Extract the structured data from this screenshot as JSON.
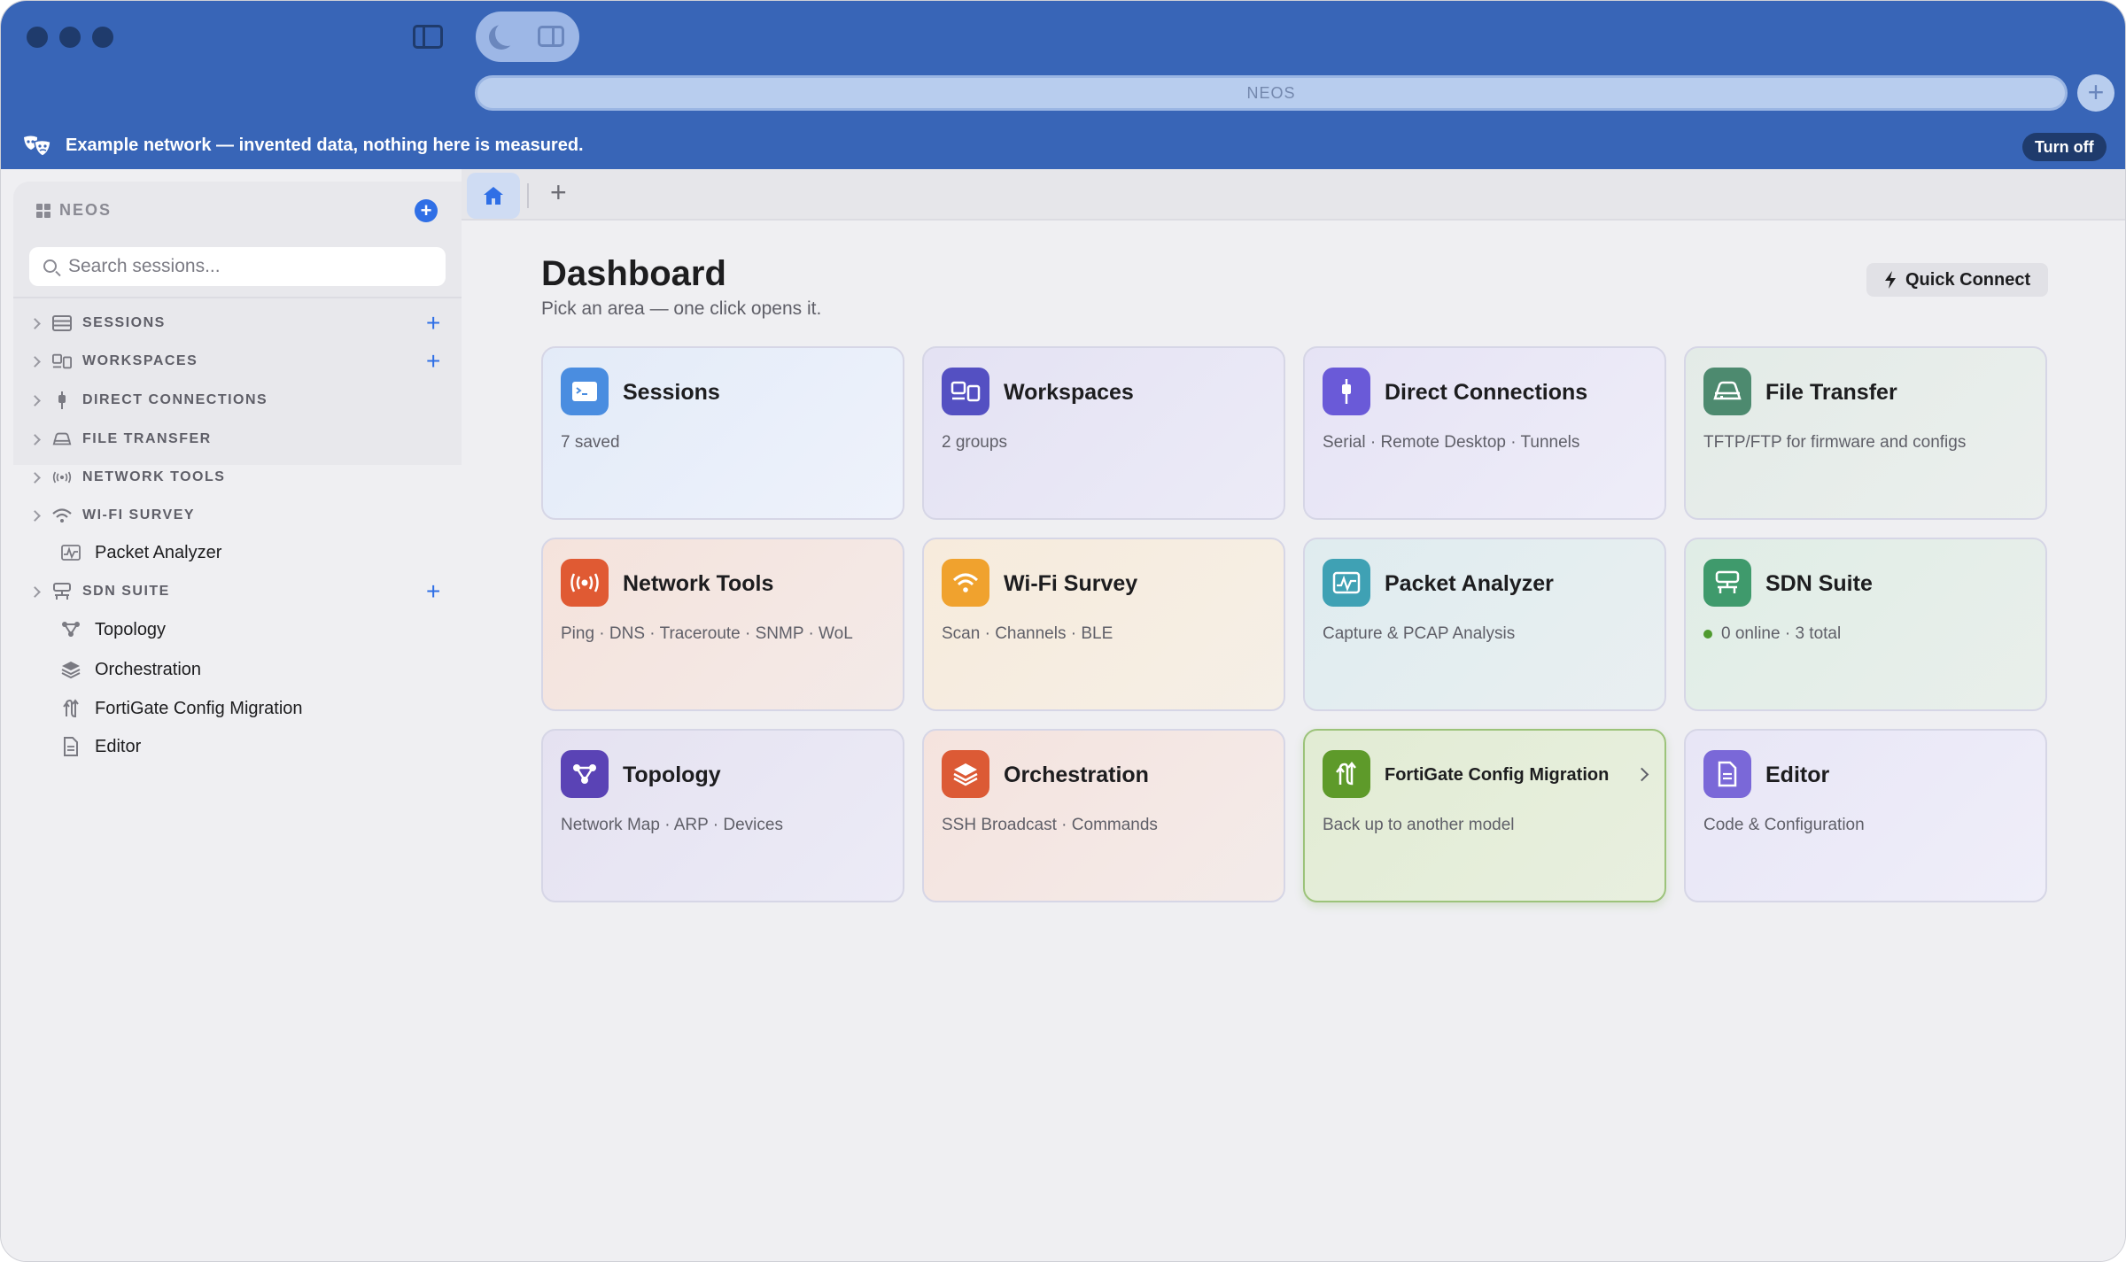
{
  "app": {
    "address": "NEOS",
    "banner_text": "Example network — invented data, nothing here is measured.",
    "banner_action": "Turn off"
  },
  "sidebar": {
    "brand": "NEOS",
    "search_placeholder": "Search sessions...",
    "items": [
      {
        "label": "SESSIONS",
        "icon": "server-icon",
        "expandable": true,
        "add": true
      },
      {
        "label": "WORKSPACES",
        "icon": "workspace-icon",
        "expandable": true,
        "add": true
      },
      {
        "label": "DIRECT CONNECTIONS",
        "icon": "plug-icon",
        "expandable": true,
        "add": false
      },
      {
        "label": "FILE TRANSFER",
        "icon": "transfer-icon",
        "expandable": true,
        "add": false
      },
      {
        "label": "NETWORK TOOLS",
        "icon": "broadcast-icon",
        "expandable": true,
        "add": false
      },
      {
        "label": "WI-FI SURVEY",
        "icon": "wifi-icon",
        "expandable": true,
        "add": false
      },
      {
        "label": "Packet Analyzer",
        "icon": "waveform-icon",
        "expandable": false,
        "add": false
      },
      {
        "label": "SDN SUITE",
        "icon": "network-device-icon",
        "expandable": true,
        "add": true
      },
      {
        "label": "Topology",
        "icon": "topology-icon",
        "expandable": false,
        "add": false
      },
      {
        "label": "Orchestration",
        "icon": "layers-icon",
        "expandable": false,
        "add": false
      },
      {
        "label": "FortiGate Config Migration",
        "icon": "migration-icon",
        "expandable": false,
        "add": false
      },
      {
        "label": "Editor",
        "icon": "document-icon",
        "expandable": false,
        "add": false
      }
    ]
  },
  "tabs": {
    "home_icon": "home-icon",
    "add_label": "+"
  },
  "main": {
    "title": "Dashboard",
    "subtitle": "Pick an area — one click opens it.",
    "quick_connect": "Quick Connect",
    "cards": [
      {
        "title": "Sessions",
        "subtitle": "7 saved",
        "icon": "terminal-icon",
        "color": "#4a8de0"
      },
      {
        "title": "Workspaces",
        "subtitle": "2 groups",
        "icon": "workspace-icon",
        "color": "#5450c2"
      },
      {
        "title": "Direct Connections",
        "subtitle": "Serial · Remote Desktop · Tunnels",
        "icon": "plug-icon",
        "color": "#6a5ad8"
      },
      {
        "title": "File Transfer",
        "subtitle": "TFTP/FTP for firmware and configs",
        "icon": "transfer-icon",
        "color": "#4d8a6f"
      },
      {
        "title": "Network Tools",
        "subtitle": "Ping · DNS · Traceroute · SNMP · WoL",
        "icon": "broadcast-icon",
        "color": "#e05a33"
      },
      {
        "title": "Wi-Fi Survey",
        "subtitle": "Scan · Channels · BLE",
        "icon": "wifi-icon",
        "color": "#f0a22e"
      },
      {
        "title": "Packet Analyzer",
        "subtitle": "Capture & PCAP Analysis",
        "icon": "waveform-icon",
        "color": "#3fa1b4"
      },
      {
        "title": "SDN Suite",
        "subtitle": "0 online · 3 total",
        "icon": "network-device-icon",
        "color": "#3f9a6c"
      },
      {
        "title": "Topology",
        "subtitle": "Network Map · ARP · Devices",
        "icon": "topology-icon",
        "color": "#5a43b5"
      },
      {
        "title": "Orchestration",
        "subtitle": "SSH Broadcast · Commands",
        "icon": "layers-icon",
        "color": "#dc5a35"
      },
      {
        "title": "FortiGate Config Migration",
        "subtitle": "Back up to another model",
        "icon": "migration-icon",
        "color": "#5e9a2a"
      },
      {
        "title": "Editor",
        "subtitle": "Code & Configuration",
        "icon": "document-icon",
        "color": "#7a68d8"
      }
    ]
  }
}
